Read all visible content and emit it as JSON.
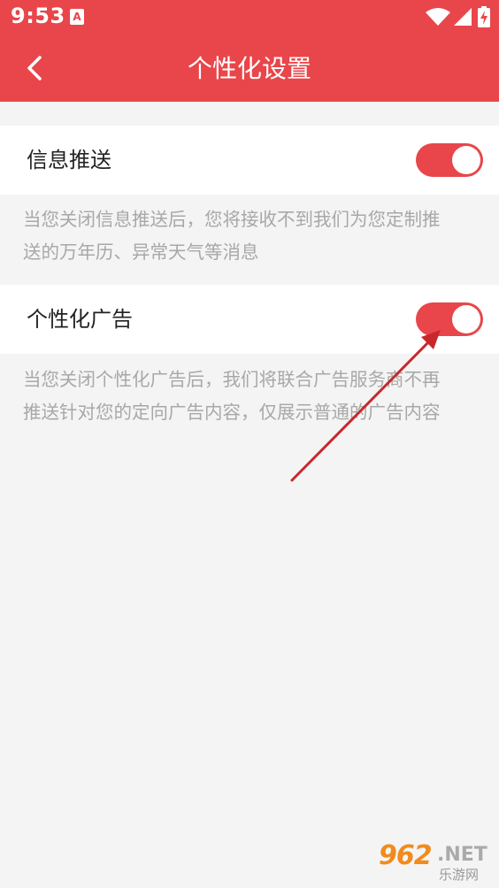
{
  "status_bar": {
    "time": "9:53",
    "icons": [
      "notification-a-icon",
      "wifi-icon",
      "signal-icon",
      "battery-charging-icon"
    ]
  },
  "header": {
    "title": "个性化设置",
    "back_icon": "chevron-left-icon"
  },
  "colors": {
    "accent": "#e8464a",
    "background": "#f4f4f4",
    "description_text": "#a8a8a8",
    "arrow": "#c8282d"
  },
  "settings": [
    {
      "label": "信息推送",
      "enabled": true,
      "description_lines": [
        "当您关闭信息推送后，您将接收不到我们为您定制推",
        "送的万年历、异常天气等消息"
      ]
    },
    {
      "label": "个性化广告",
      "enabled": true,
      "description_lines": [
        "当您关闭个性化广告后，我们将联合广告服务商不再",
        "推送针对您的定向广告内容，仅展示普通的广告内容"
      ]
    }
  ],
  "watermark": {
    "number": "962",
    "suffix": ".NET",
    "text": "乐游网"
  }
}
